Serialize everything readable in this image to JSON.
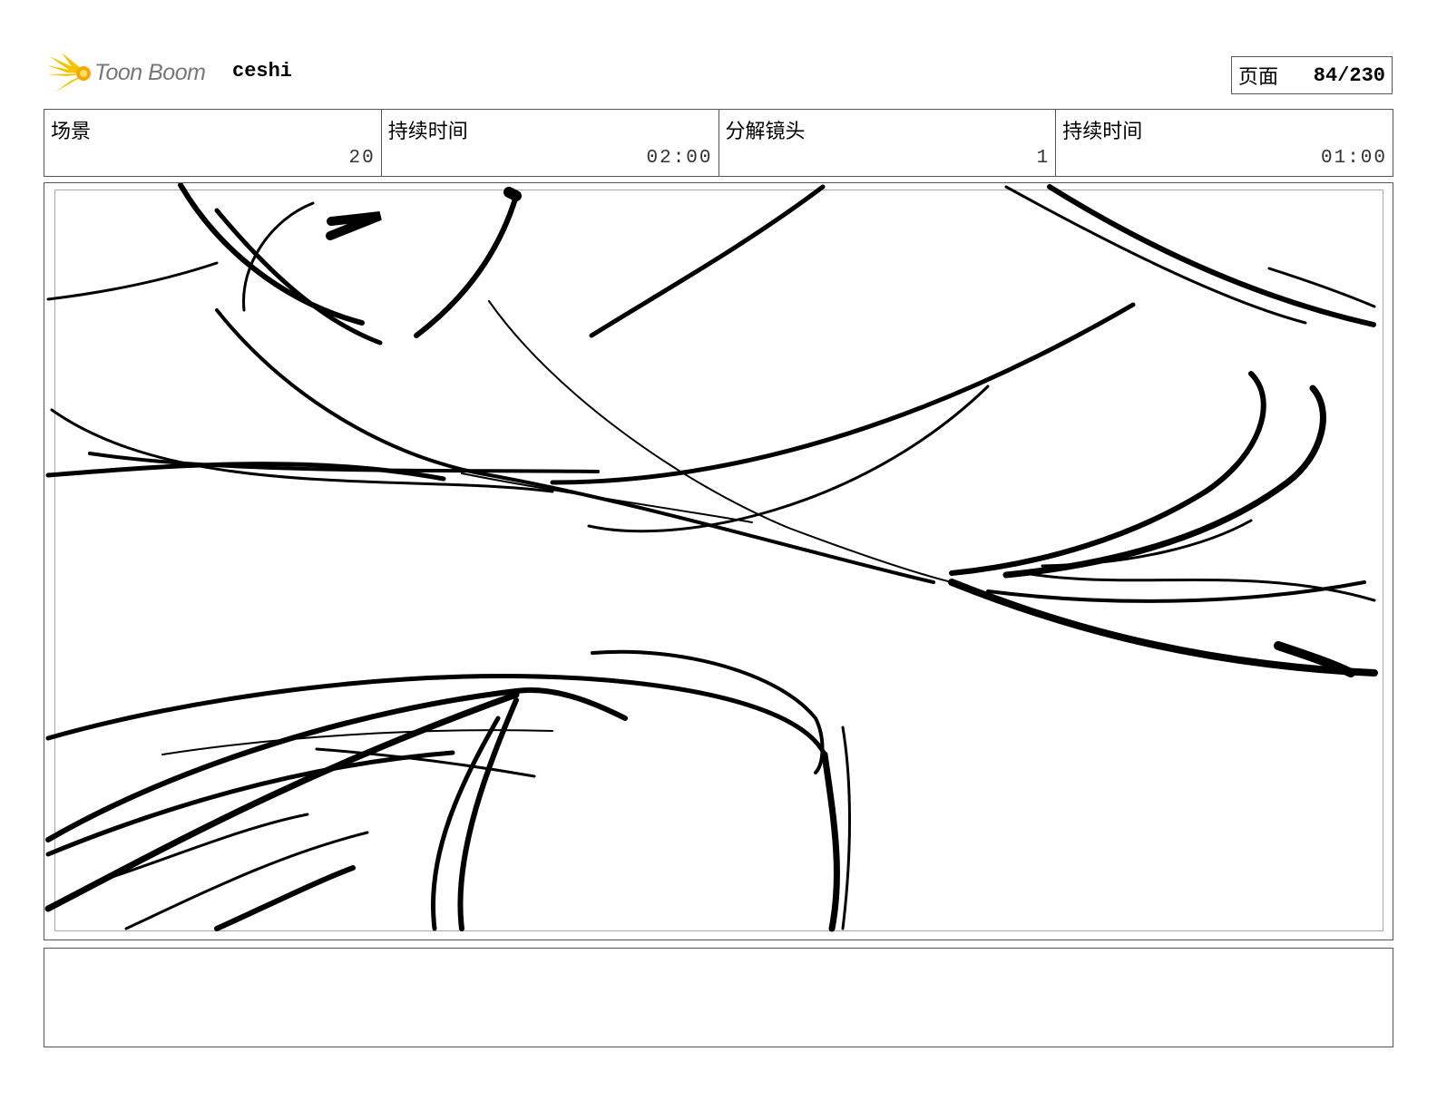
{
  "header": {
    "logo_text": "Toon Boom",
    "logo_icon": "starburst-icon",
    "project_title": "ceshi",
    "page_label": "页面",
    "page_value": "84/230"
  },
  "info": {
    "scene_label": "场景",
    "scene_value": "20",
    "scene_duration_label": "持续时间",
    "scene_duration_value": "02:00",
    "panel_label": "分解镜头",
    "panel_value": "1",
    "panel_duration_label": "持续时间",
    "panel_duration_value": "01:00"
  },
  "panel": {
    "content": "sketch-drawing"
  },
  "notes": {
    "text": ""
  },
  "colors": {
    "border": "#555555",
    "logo_yellow": "#f5c400",
    "logo_text": "#777777"
  }
}
